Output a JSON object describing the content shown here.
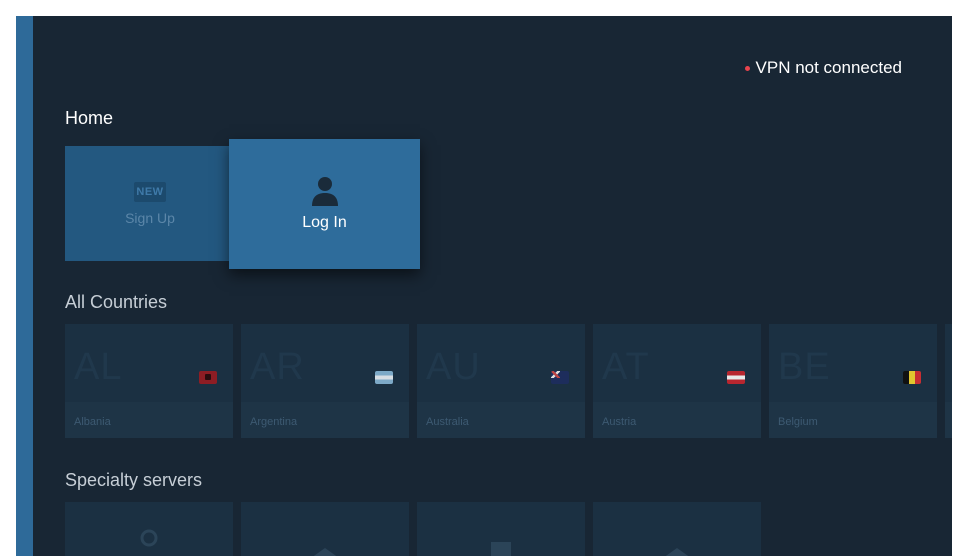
{
  "status": {
    "text": "VPN not connected",
    "dot_color": "#e8444d"
  },
  "home": {
    "title": "Home",
    "tiles": [
      {
        "label": "Sign Up",
        "badge": "NEW",
        "icon": "new-badge-icon"
      },
      {
        "label": "Log In",
        "icon": "user-icon"
      }
    ]
  },
  "countries": {
    "title": "All Countries",
    "items": [
      {
        "code": "AL",
        "name": "Albania",
        "flag": "albania-flag-icon"
      },
      {
        "code": "AR",
        "name": "Argentina",
        "flag": "argentina-flag-icon"
      },
      {
        "code": "AU",
        "name": "Australia",
        "flag": "australia-flag-icon"
      },
      {
        "code": "AT",
        "name": "Austria",
        "flag": "austria-flag-icon"
      },
      {
        "code": "BE",
        "name": "Belgium",
        "flag": "belgium-flag-icon"
      }
    ]
  },
  "specialty": {
    "title": "Specialty servers",
    "icons": [
      "user-icon",
      "diamond-icon",
      "square-icon",
      "diamond-icon"
    ]
  },
  "colors": {
    "accent": "#2e6c9b",
    "background": "#182634",
    "sidebar": "#2e6a99"
  }
}
